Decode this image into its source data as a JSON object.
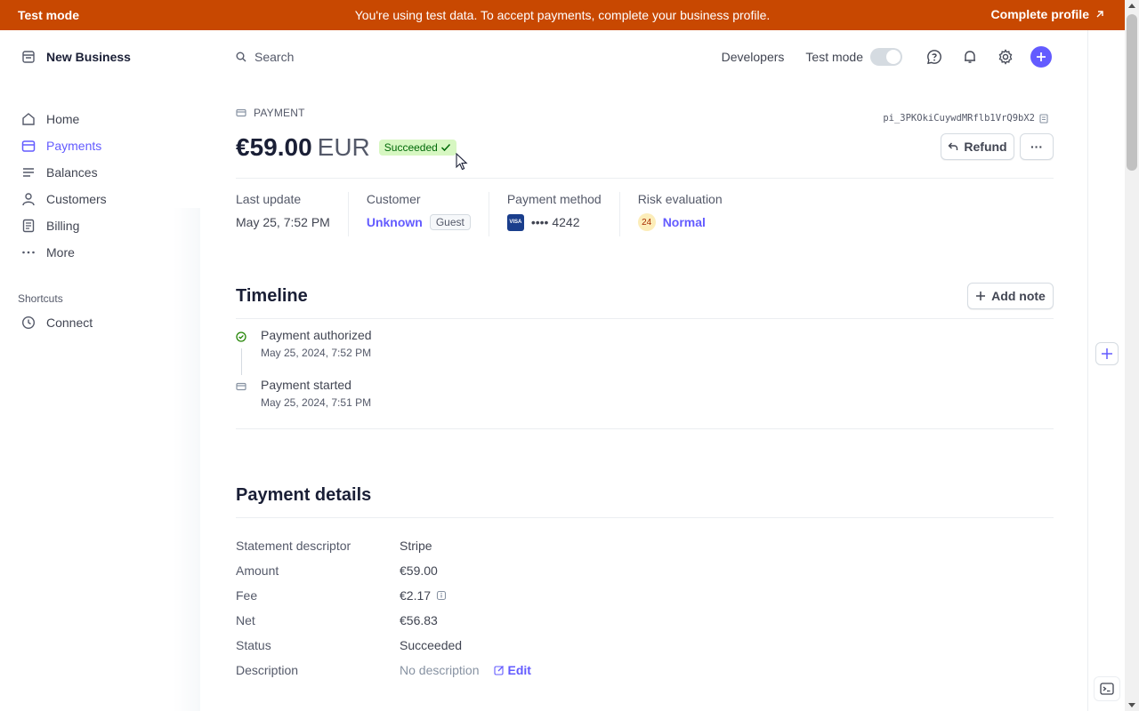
{
  "banner": {
    "left": "Test mode",
    "message": "You're using test data. To accept payments, complete your business profile.",
    "cta": "Complete profile"
  },
  "sidebar": {
    "business_name": "New Business",
    "items": [
      {
        "label": "Home",
        "icon": "home-icon"
      },
      {
        "label": "Payments",
        "icon": "wallet-icon",
        "active": true
      },
      {
        "label": "Balances",
        "icon": "balance-icon"
      },
      {
        "label": "Customers",
        "icon": "person-icon"
      },
      {
        "label": "Billing",
        "icon": "billing-icon"
      },
      {
        "label": "More",
        "icon": "more-dots-icon"
      }
    ],
    "shortcuts_title": "Shortcuts",
    "shortcuts": [
      {
        "label": "Connect",
        "icon": "clock-icon"
      }
    ]
  },
  "topbar": {
    "search_placeholder": "Search",
    "developers": "Developers",
    "test_mode": "Test mode",
    "test_mode_on": false
  },
  "payment": {
    "kind": "PAYMENT",
    "id": "pi_3PKOkiCuywdMRflb1VrQ9bX2",
    "amount": "€59.00",
    "currency": "EUR",
    "status": "Succeeded",
    "refund_label": "Refund",
    "more_label": "···"
  },
  "summary": {
    "last_update_label": "Last update",
    "last_update": "May 25, 7:52 PM",
    "customer_label": "Customer",
    "customer": "Unknown",
    "customer_badge": "Guest",
    "method_label": "Payment method",
    "card_brand": "VISA",
    "card_last4": "•••• 4242",
    "risk_label": "Risk evaluation",
    "risk_score": "24",
    "risk_level": "Normal"
  },
  "timeline": {
    "title": "Timeline",
    "add_note": "Add note",
    "events": [
      {
        "title": "Payment authorized",
        "time": "May 25, 2024, 7:52 PM",
        "icon": "check-circle-icon"
      },
      {
        "title": "Payment started",
        "time": "May 25, 2024, 7:51 PM",
        "icon": "payment-icon"
      }
    ]
  },
  "details": {
    "title": "Payment details",
    "rows": [
      {
        "label": "Statement descriptor",
        "value": "Stripe"
      },
      {
        "label": "Amount",
        "value": "€59.00"
      },
      {
        "label": "Fee",
        "value": "€2.17"
      },
      {
        "label": "Net",
        "value": "€56.83"
      },
      {
        "label": "Status",
        "value": "Succeeded"
      },
      {
        "label": "Description",
        "value": "No description"
      }
    ],
    "edit_label": "Edit"
  },
  "colors": {
    "banner": "#c84801",
    "accent": "#635bff",
    "success_bg": "#d7f7c2",
    "success_text": "#006908"
  }
}
